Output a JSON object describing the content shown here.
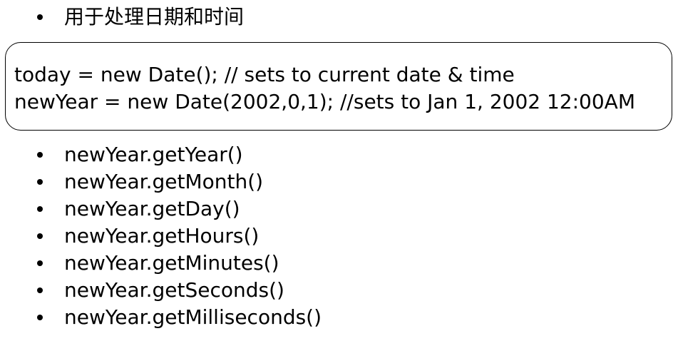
{
  "heading": {
    "text": "用于处理日期和时间"
  },
  "code_box": {
    "lines": [
      "today = new Date(); // sets to current date & time",
      "newYear = new Date(2002,0,1); //sets to Jan 1, 2002 12:00AM"
    ]
  },
  "methods": [
    "newYear.getYear()",
    "newYear.getMonth()",
    "newYear.getDay()",
    "newYear.getHours()",
    "newYear.getMinutes()",
    "newYear.getSeconds()",
    "newYear.getMilliseconds()"
  ]
}
